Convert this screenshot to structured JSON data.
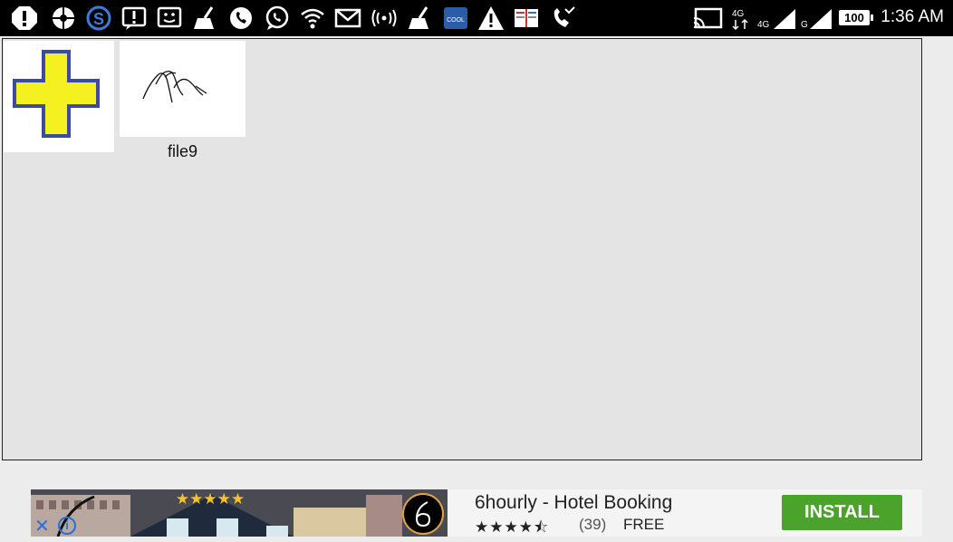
{
  "status_bar": {
    "left_icons": [
      "alert-icon",
      "camera-shutter-icon",
      "s-app-icon",
      "message-alert-icon",
      "face-icon",
      "cleaner-icon",
      "phone-icon",
      "whatsapp-icon",
      "wifi-icon",
      "mail-icon",
      "hotspot-icon",
      "cleaner-icon-2",
      "app-badge-icon",
      "warning-icon",
      "book-icon",
      "missed-call-icon"
    ],
    "right_icons": [
      "cast-icon",
      "data-4g-icon",
      "signal-4g-icon",
      "signal-g-icon"
    ],
    "network_label_1": "4G",
    "network_label_2": "4G",
    "network_label_3": "G",
    "battery": "100",
    "time": "1:36 AM"
  },
  "panel": {
    "new_item_icon": "plus-icon",
    "files": [
      {
        "name": "file9",
        "thumbnail": "scribble-drawing"
      }
    ]
  },
  "ad": {
    "title": "6hourly - Hotel Booking",
    "stars": "★★★★⯪",
    "rating_count": "(39)",
    "price": "FREE",
    "install_label": "INSTALL",
    "close_glyph": "✕",
    "info_glyph": "i",
    "image_stars": "★★★★★"
  },
  "colors": {
    "plus_fill": "#f5f020",
    "plus_outline": "#3c4aa0",
    "install_green": "#4ba32b"
  }
}
